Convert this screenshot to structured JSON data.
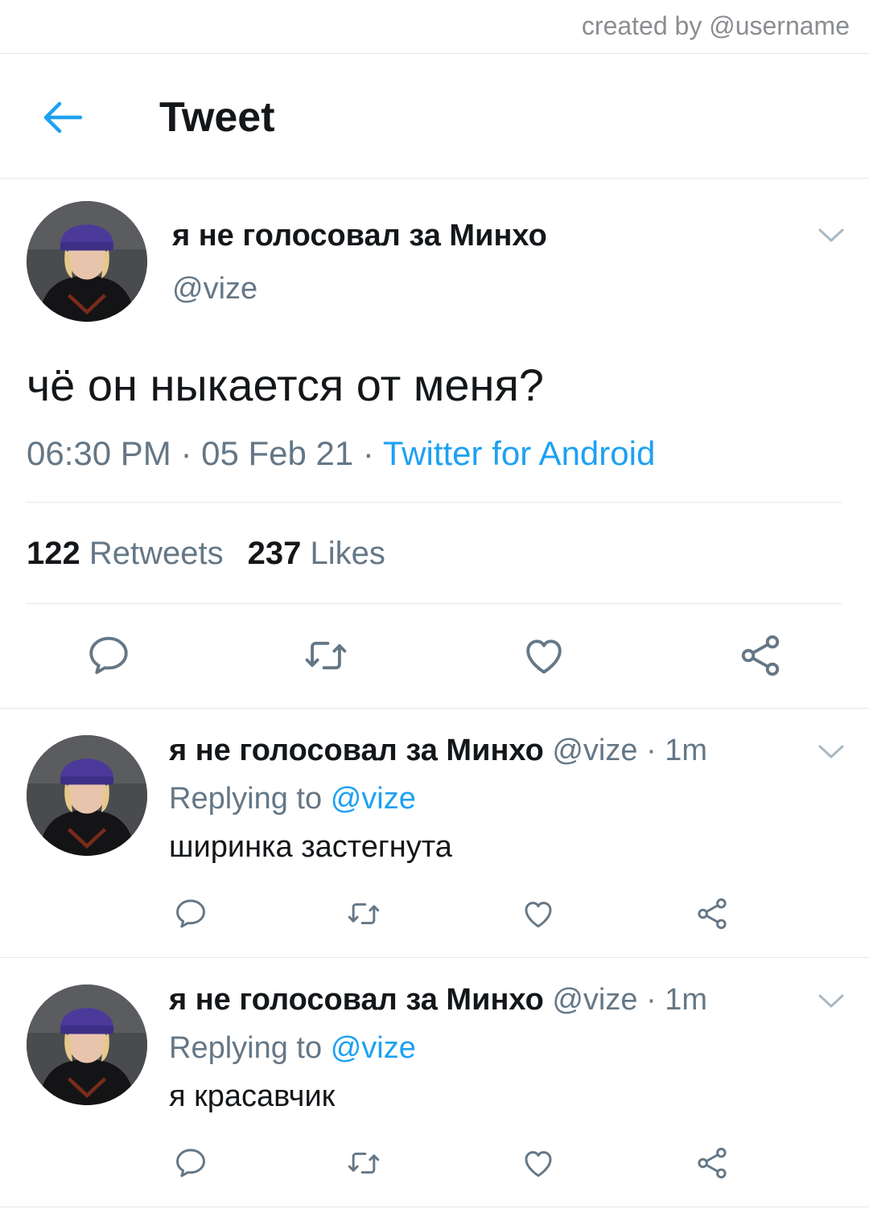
{
  "watermark": "created by @username",
  "header": {
    "title": "Tweet"
  },
  "tweet": {
    "name": "я не голосовал за Минхо",
    "handle": "@vize",
    "text": "чё он ныкается от меня?",
    "time": "06:30 PM",
    "date": "05 Feb 21",
    "sep": " · ",
    "source": "Twitter for Android",
    "retweets_count": "122",
    "retweets_label": "Retweets",
    "likes_count": "237",
    "likes_label": "Likes"
  },
  "replies": [
    {
      "name": "я не голосовал за Минхо",
      "handle": "@vize",
      "time": "1m",
      "replying_label": "Replying to",
      "replying_handle": "@vize",
      "text": "ширинка застегнута"
    },
    {
      "name": "я не голосовал за Минхо",
      "handle": "@vize",
      "time": "1m",
      "replying_label": "Replying to",
      "replying_handle": "@vize",
      "text": "я красавчик"
    }
  ],
  "colors": {
    "accent": "#1da1f2",
    "muted": "#657786",
    "divider": "#e1e8ed",
    "beanie": "#4b3a9a"
  },
  "icons": [
    "back-arrow-icon",
    "chevron-down-icon",
    "reply-icon",
    "retweet-icon",
    "like-icon",
    "share-icon"
  ]
}
